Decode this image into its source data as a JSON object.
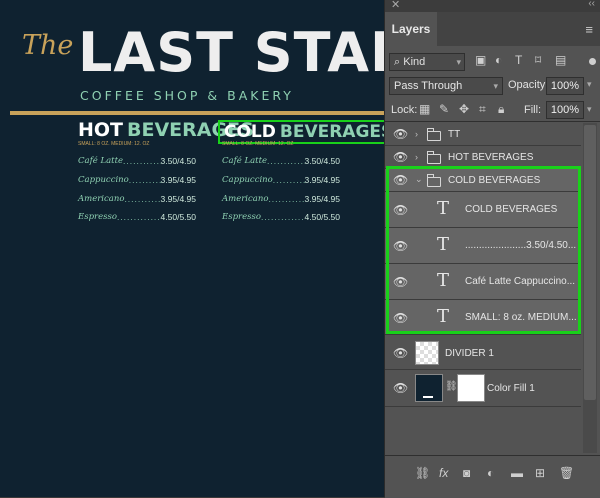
{
  "canvas": {
    "the": "The",
    "title": "LAST STAND",
    "subtitle": "COFFEE SHOP & BAKERY",
    "hot": {
      "word1": "HOT",
      "word2": "BEVERAGES",
      "sizes": "SMALL: 8 OZ. MEDIUM: 12. OZ",
      "items": [
        {
          "name": "Café Latte",
          "dots": "......................................................",
          "price": "3.50/4.50"
        },
        {
          "name": "Cappuccino",
          "dots": "......................................................",
          "price": "3.95/4.95"
        },
        {
          "name": "Americano",
          "dots": "......................................................",
          "price": "3.95/4.95"
        },
        {
          "name": "Espresso",
          "dots": "......................................................",
          "price": "4.50/5.50"
        }
      ]
    },
    "cold": {
      "word1": "COLD",
      "word2": "BEVERAGES",
      "sizes": "SMALL: 8 OZ. MEDIUM: 12. OZ",
      "items": [
        {
          "name": "Café Latte",
          "dots": "......................................................",
          "price": "3.50/4.50"
        },
        {
          "name": "Cappuccino",
          "dots": "......................................................",
          "price": "3.95/4.95"
        },
        {
          "name": "Americano",
          "dots": "......................................................",
          "price": "3.95/4.95"
        },
        {
          "name": "Espresso",
          "dots": "......................................................",
          "price": "4.50/5.50"
        }
      ]
    }
  },
  "panel": {
    "close": "✕",
    "collapse": "‹‹",
    "tab": "Layers",
    "menu": "≡",
    "filter_kind": "Kind",
    "blend_mode": "Pass Through",
    "opacity_label": "Opacity:",
    "opacity_value": "100%",
    "lock_label": "Lock:",
    "fill_label": "Fill:",
    "fill_value": "100%",
    "layers": [
      {
        "name": "TT"
      },
      {
        "name": "HOT BEVERAGES"
      },
      {
        "name": "COLD BEVERAGES"
      },
      {
        "name": "COLD BEVERAGES"
      },
      {
        "name": "......................3.50/4.50..."
      },
      {
        "name": "Café Latte Cappuccino..."
      },
      {
        "name": "SMALL: 8 oz. MEDIUM..."
      },
      {
        "name": "DIVIDER 1"
      },
      {
        "name": "Color Fill 1"
      }
    ]
  },
  "colors": {
    "canvas_bg": "#0f2230",
    "gold": "#c8a25a",
    "mint": "#8fd1b2",
    "highlight": "#19d11a"
  }
}
